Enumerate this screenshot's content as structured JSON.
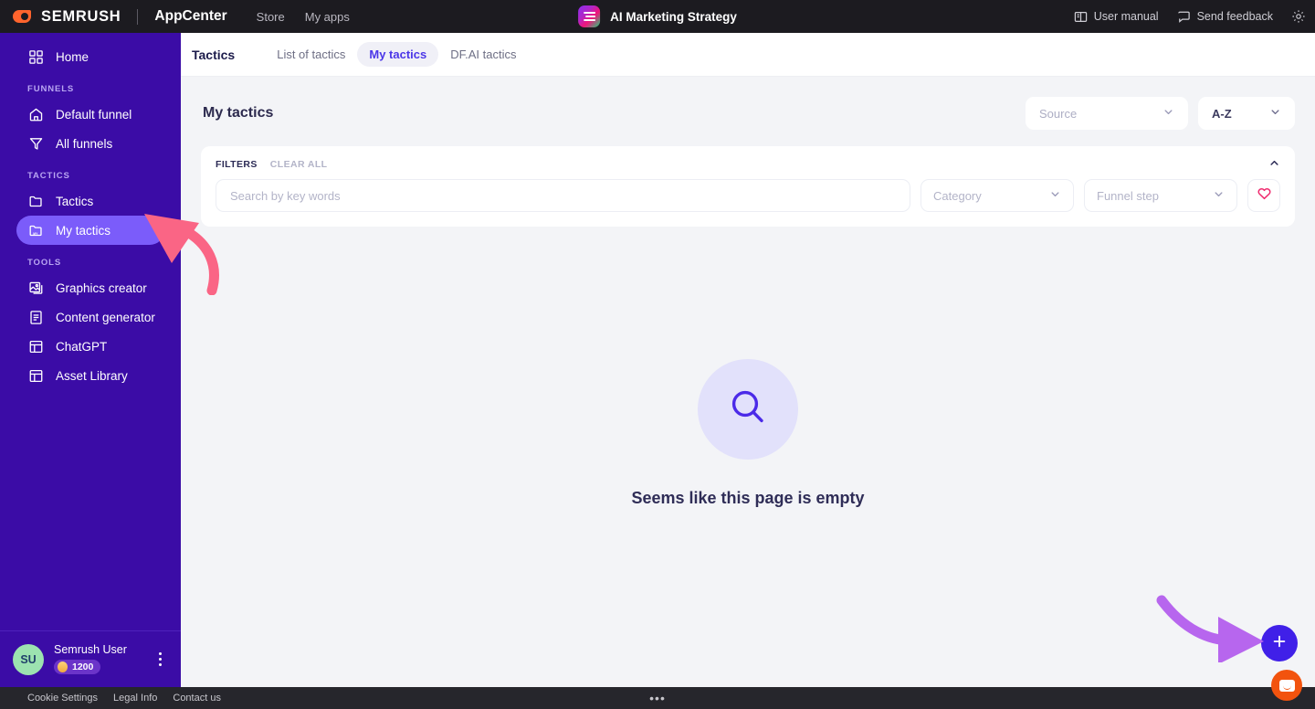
{
  "topbar": {
    "brand": "SEMRUSH",
    "brand_app": "AppCenter",
    "nav": [
      {
        "label": "Store",
        "name": "topnav-store"
      },
      {
        "label": "My apps",
        "name": "topnav-my-apps"
      }
    ],
    "app_title": "AI Marketing Strategy",
    "right": [
      {
        "label": "User manual",
        "icon": "book-icon"
      },
      {
        "label": "Send feedback",
        "icon": "chat-icon"
      }
    ],
    "settings_icon": "gear-icon"
  },
  "sidebar": {
    "home": {
      "label": "Home",
      "icon": "grid-icon"
    },
    "sections": [
      {
        "heading": "FUNNELS",
        "items": [
          {
            "label": "Default funnel",
            "icon": "home-outline-icon",
            "active": false
          },
          {
            "label": "All funnels",
            "icon": "funnel-icon",
            "active": false
          }
        ]
      },
      {
        "heading": "TACTICS",
        "items": [
          {
            "label": "Tactics",
            "icon": "folder-icon",
            "active": false
          },
          {
            "label": "My tactics",
            "icon": "folder-my-icon",
            "active": true
          }
        ]
      },
      {
        "heading": "TOOLS",
        "items": [
          {
            "label": "Graphics creator",
            "icon": "image-icon",
            "active": false
          },
          {
            "label": "Content generator",
            "icon": "document-lines-icon",
            "active": false
          },
          {
            "label": "ChatGPT",
            "icon": "layout-icon",
            "active": false
          },
          {
            "label": "Asset Library",
            "icon": "layout-icon",
            "active": false
          }
        ]
      }
    ],
    "user": {
      "initials": "SU",
      "name": "Semrush User",
      "credits": "1200",
      "credits_icon": "coin-icon",
      "menu_icon": "kebab-vertical-icon"
    }
  },
  "footer": {
    "links": [
      "Cookie Settings",
      "Legal Info",
      "Contact us"
    ],
    "dots": "•••"
  },
  "tabsbar": {
    "title": "Tactics",
    "tabs": [
      {
        "label": "List of tactics",
        "active": false
      },
      {
        "label": "My tactics",
        "active": true
      },
      {
        "label": "DF.AI tactics",
        "active": false
      }
    ]
  },
  "content": {
    "page_title": "My tactics",
    "source_select": {
      "value": "Source",
      "icon": "chevron-down-icon"
    },
    "sort_select": {
      "value": "A-Z",
      "icon": "chevron-down-icon"
    },
    "filters": {
      "label": "FILTERS",
      "clear_all": "CLEAR ALL",
      "collapse_icon": "chevron-up-icon",
      "search_placeholder": "Search by key words",
      "search_value": "",
      "category": {
        "value": "Category",
        "icon": "chevron-down-icon"
      },
      "funnel_step": {
        "value": "Funnel step",
        "icon": "chevron-down-icon"
      },
      "favorite_icon": "heart-outline-icon"
    },
    "empty": {
      "icon": "search-icon",
      "text": "Seems like this page is empty"
    }
  },
  "widgets": {
    "fab": {
      "icon": "plus-icon"
    },
    "intercom": {
      "icon": "chat-bubble-icon"
    }
  },
  "colors": {
    "sidebar_bg": "#3b0ca6",
    "sidebar_active": "#7b5cfa",
    "topbar_bg": "#1c1b20",
    "accent": "#4b36e8",
    "fab": "#4020e8",
    "intercom": "#f2530e",
    "heart": "#ef2a6e",
    "arrow_pink": "#fa6585",
    "arrow_purple": "#b766ee"
  }
}
